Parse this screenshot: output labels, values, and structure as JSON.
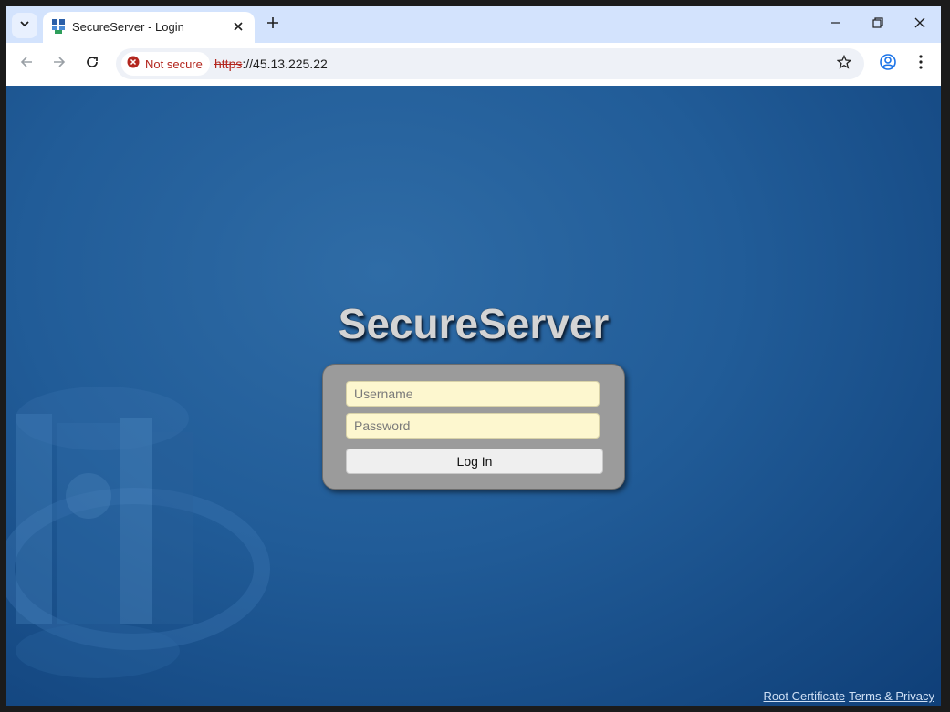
{
  "browser": {
    "tab": {
      "title": "SecureServer - Login",
      "favicon": "server-favicon-icon"
    },
    "controls": {
      "tab_search_icon": "chevron-down-icon",
      "new_tab_icon": "plus-icon",
      "minimize_icon": "minimize-icon",
      "restore_icon": "restore-icon",
      "close_icon": "close-icon"
    },
    "toolbar": {
      "back_icon": "arrow-left-icon",
      "forward_icon": "arrow-right-icon",
      "reload_icon": "reload-icon",
      "security_label": "Not secure",
      "url_scheme": "https",
      "url_rest": "://45.13.225.22",
      "bookmark_icon": "star-icon",
      "profile_icon": "profile-icon",
      "menu_icon": "more-vert-icon"
    }
  },
  "page": {
    "brand_title": "SecureServer",
    "login": {
      "username_placeholder": "Username",
      "password_placeholder": "Password",
      "submit_label": "Log In"
    },
    "footer": {
      "root_certificate_link": "Root Certificate",
      "terms_link": "Terms & Privacy"
    }
  },
  "colors": {
    "not_secure": "#b3261e",
    "page_background": "#215c98",
    "login_box": "#9b9b9b",
    "input_background": "#fdf7cf",
    "footer_link": "#cfe0f5"
  }
}
